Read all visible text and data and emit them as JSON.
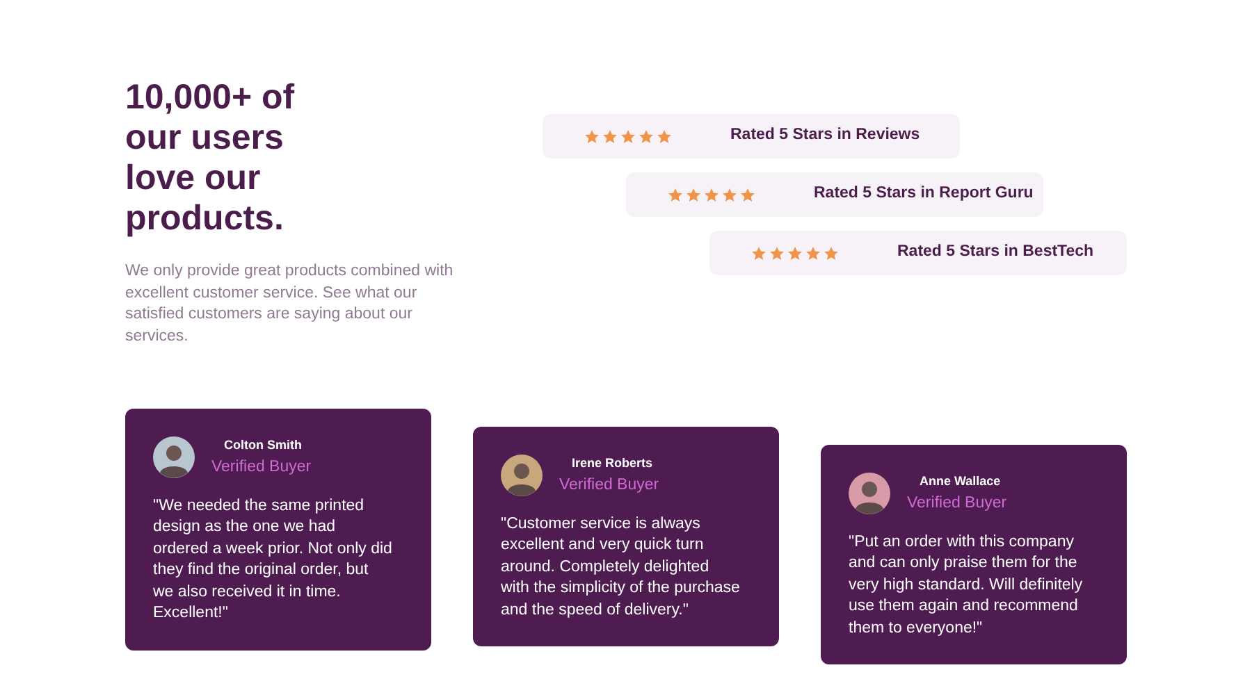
{
  "heading": "10,000+ of our users love our products.",
  "intro": "We only provide great products combined with excellent customer service. See what our satisfied customers are saying about our services.",
  "ratings": [
    {
      "stars": 5,
      "label": "Rated 5 Stars in Reviews"
    },
    {
      "stars": 5,
      "label": "Rated 5 Stars in Report Guru"
    },
    {
      "stars": 5,
      "label": "Rated 5 Stars in BestTech"
    }
  ],
  "testimonials": [
    {
      "name": "Colton Smith",
      "badge": "Verified Buyer",
      "quote": "\"We needed the same printed design as the one we had ordered a week prior. Not only did they find the original order, but we also received it in time. Excellent!\""
    },
    {
      "name": "Irene Roberts",
      "badge": "Verified Buyer",
      "quote": "\"Customer service is always excellent and very quick turn around. Completely delighted with the simplicity of the purchase and the speed of delivery.\""
    },
    {
      "name": "Anne Wallace",
      "badge": "Verified Buyer",
      "quote": "\"Put an order with this company and can only praise them for the very high standard. Will definitely use them again and recommend them to everyone!\""
    }
  ]
}
